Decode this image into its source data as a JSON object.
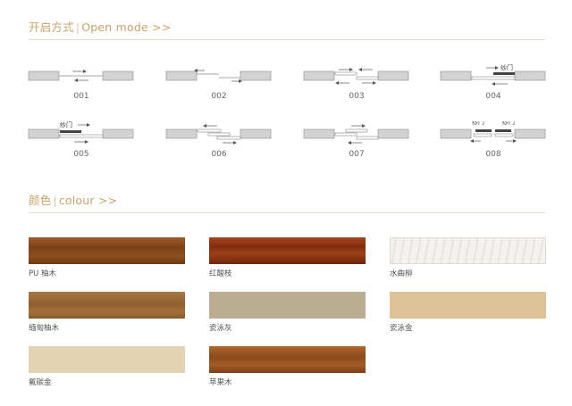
{
  "open_mode": {
    "title_cn": "开启方式",
    "title_en": "Open mode",
    "arrows": ">>",
    "items": [
      {
        "code": "001"
      },
      {
        "code": "002"
      },
      {
        "code": "003"
      },
      {
        "code": "004",
        "tags": [
          "纱门"
        ]
      },
      {
        "code": "005",
        "tags": [
          "纱门"
        ]
      },
      {
        "code": "006"
      },
      {
        "code": "007"
      },
      {
        "code": "008",
        "tags": [
          "纱门",
          "纱门"
        ]
      }
    ]
  },
  "colour": {
    "title_cn": "颜色",
    "title_en": "colour",
    "arrows": ">>",
    "swatches": [
      {
        "name": "PU 柚木",
        "color": "#8a4e22"
      },
      {
        "name": "红酸枝",
        "color": "#8f3a18"
      },
      {
        "name": "水曲柳",
        "color": "#f1eee8"
      },
      {
        "name": "缅甸柚木",
        "color": "#9a6a3a"
      },
      {
        "name": "瓷泳灰",
        "color": "#bcac91"
      },
      {
        "name": "瓷泳金",
        "color": "#ddc396"
      },
      {
        "name": "氟碳金",
        "color": "#e3d2b4"
      },
      {
        "name": "苹果木",
        "color": "#9b5424"
      }
    ]
  }
}
